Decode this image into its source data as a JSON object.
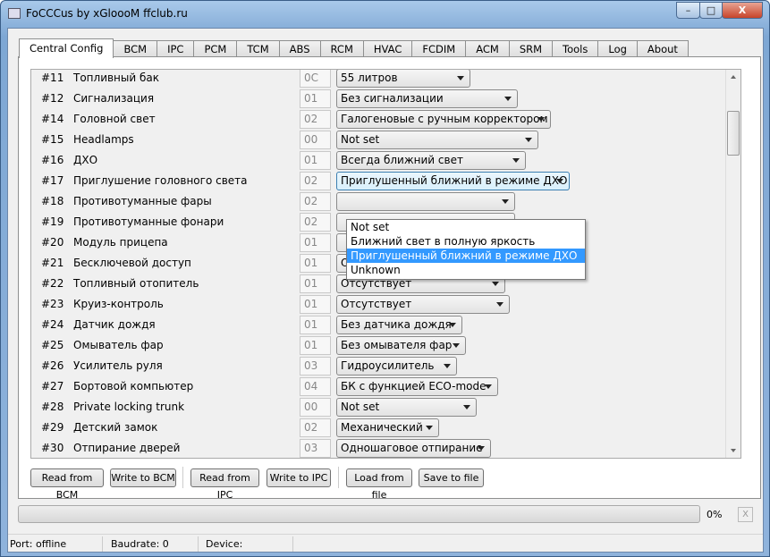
{
  "window": {
    "title": "FoCCCus by xGloooM ffclub.ru",
    "minimize": "–",
    "maximize": "□",
    "close": "X"
  },
  "tabs": [
    "Central Config",
    "BCM",
    "IPC",
    "PCM",
    "TCM",
    "ABS",
    "RCM",
    "HVAC",
    "FCDIM",
    "ACM",
    "SRM",
    "Tools",
    "Log",
    "About"
  ],
  "active_tab": "Central Config",
  "rows": [
    {
      "num": "#11",
      "label": "Топливный бак",
      "hex": "0C",
      "value": "55 литров",
      "w": 150
    },
    {
      "num": "#12",
      "label": "Сигнализация",
      "hex": "01",
      "value": "Без сигнализации",
      "w": 203
    },
    {
      "num": "#14",
      "label": "Головной свет",
      "hex": "02",
      "value": "Галогеновые с ручным корректором",
      "w": 240
    },
    {
      "num": "#15",
      "label": "Headlamps",
      "hex": "00",
      "value": "Not set",
      "w": 226
    },
    {
      "num": "#16",
      "label": "ДХО",
      "hex": "01",
      "value": "Всегда ближний свет",
      "w": 212
    },
    {
      "num": "#17",
      "label": "Приглушение головного света",
      "hex": "02",
      "value": "Приглушенный ближний в режиме ДХО",
      "w": 261,
      "active": true
    },
    {
      "num": "#18",
      "label": "Противотуманные фары",
      "hex": "02",
      "value": "",
      "w": 200
    },
    {
      "num": "#19",
      "label": "Противотуманные фонари",
      "hex": "02",
      "value": "",
      "w": 200
    },
    {
      "num": "#20",
      "label": "Модуль прицепа",
      "hex": "01",
      "value": "",
      "w": 147
    },
    {
      "num": "#21",
      "label": "Бесключевой доступ",
      "hex": "01",
      "value": "Отсутствует",
      "w": 203
    },
    {
      "num": "#22",
      "label": "Топливный отопитель",
      "hex": "01",
      "value": "Отсутствует",
      "w": 189
    },
    {
      "num": "#23",
      "label": "Круиз-контроль",
      "hex": "01",
      "value": "Отсутствует",
      "w": 194
    },
    {
      "num": "#24",
      "label": "Датчик дождя",
      "hex": "01",
      "value": "Без датчика дождя",
      "w": 141
    },
    {
      "num": "#25",
      "label": "Омыватель фар",
      "hex": "01",
      "value": "Без омывателя фар",
      "w": 145
    },
    {
      "num": "#26",
      "label": "Усилитель руля",
      "hex": "03",
      "value": "Гидроусилитель",
      "w": 135
    },
    {
      "num": "#27",
      "label": "Бортовой компьютер",
      "hex": "04",
      "value": "БК с функцией ECO-mode",
      "w": 181
    },
    {
      "num": "#28",
      "label": "Private locking trunk",
      "hex": "00",
      "value": "Not set",
      "w": 157
    },
    {
      "num": "#29",
      "label": "Детский замок",
      "hex": "02",
      "value": "Механический",
      "w": 115
    },
    {
      "num": "#30",
      "label": "Отпирание дверей",
      "hex": "03",
      "value": "Одношаговое отпирание",
      "w": 173
    }
  ],
  "dropdown_options": [
    "Not set",
    "Ближний свет в полную яркость",
    "Приглушенный ближний в режиме ДХО",
    "Unknown"
  ],
  "dropdown_selected": 2,
  "buttons": {
    "read_bcm": "Read from BCM",
    "write_bcm": "Write to BCM",
    "read_ipc": "Read from IPC",
    "write_ipc": "Write to IPC",
    "load": "Load from file",
    "save": "Save to file"
  },
  "progress": {
    "value": 0,
    "label": "0%",
    "cancel": "X"
  },
  "status": {
    "port": "Port: offline",
    "baudrate": "Baudrate: 0",
    "device": "Device:"
  }
}
